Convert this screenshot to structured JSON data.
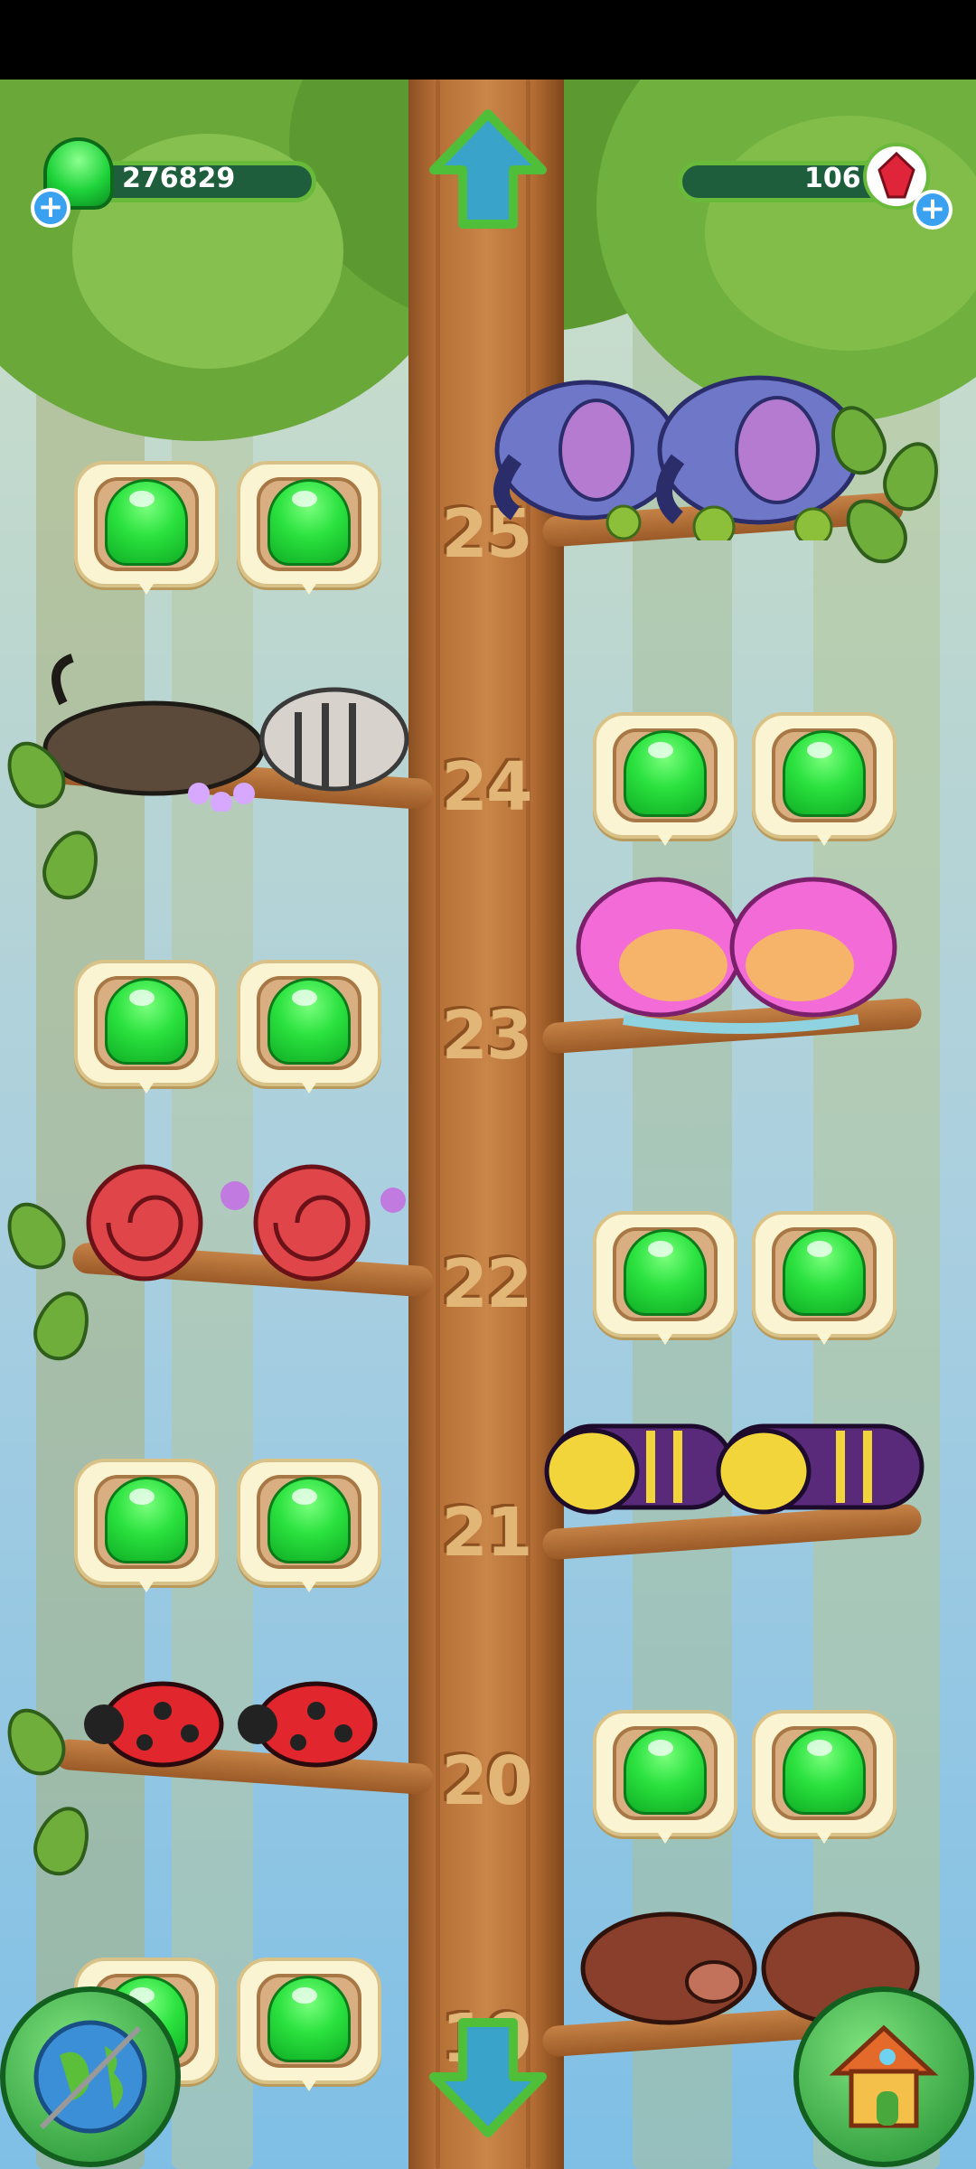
{
  "hud": {
    "jelly_count": "276829",
    "gem_count": "106"
  },
  "levels": [
    {
      "label": "25"
    },
    {
      "label": "24"
    },
    {
      "label": "23"
    },
    {
      "label": "22"
    },
    {
      "label": "21"
    },
    {
      "label": "20"
    },
    {
      "label": "19"
    }
  ],
  "branches": [
    {
      "level": "25",
      "side": "right",
      "creature": "elephant",
      "pads": 0
    },
    {
      "level": "24",
      "side": "left",
      "creature": "wildebeest-and-zebra",
      "pads": 2
    },
    {
      "level": "23",
      "side": "right",
      "creature": "pink-fish",
      "pads": 2
    },
    {
      "level": "22",
      "side": "left",
      "creature": "red-snail",
      "pads": 2
    },
    {
      "level": "21",
      "side": "right",
      "creature": "caterpillar",
      "pads": 2
    },
    {
      "level": "20",
      "side": "left",
      "creature": "ladybug",
      "pads": 2
    },
    {
      "level": "19",
      "side": "right",
      "creature": "boar",
      "pads": 2
    }
  ],
  "icons": {
    "up": "arrow-up-icon",
    "down": "arrow-down-icon",
    "globe": "globe-icon",
    "house": "house-icon",
    "jelly": "jelly-icon",
    "gem": "gem-icon"
  },
  "colors": {
    "jelly": "#2be23f",
    "trunk": "#c98648",
    "hud_bar": "#1f5e3c"
  }
}
